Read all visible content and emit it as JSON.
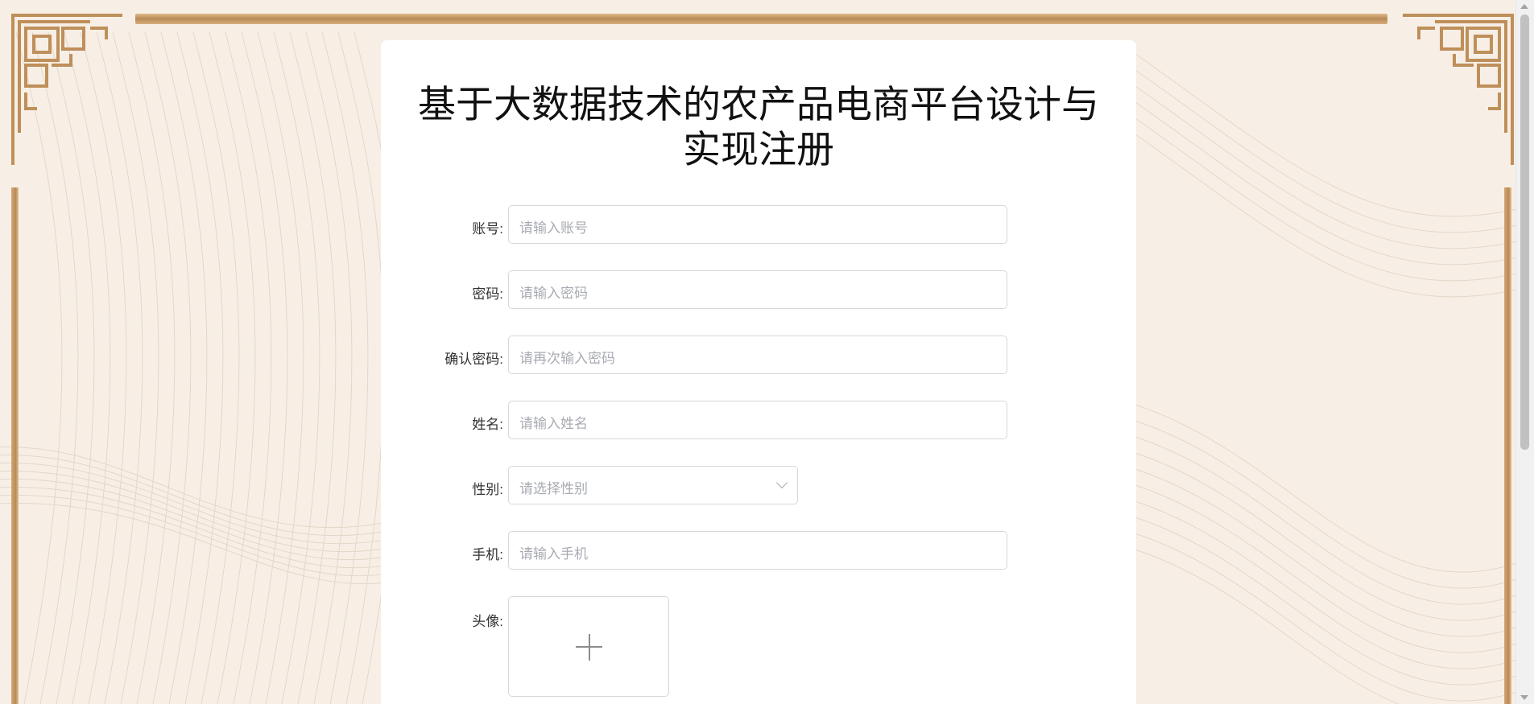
{
  "page": {
    "title": "基于大数据技术的农产品电商平台设计与实现注册"
  },
  "form": {
    "fields": [
      {
        "label": "账号:",
        "placeholder": "请输入账号",
        "type": "text"
      },
      {
        "label": "密码:",
        "placeholder": "请输入密码",
        "type": "password"
      },
      {
        "label": "确认密码:",
        "placeholder": "请再次输入密码",
        "type": "password"
      },
      {
        "label": "姓名:",
        "placeholder": "请输入姓名",
        "type": "text"
      },
      {
        "label": "性别:",
        "placeholder": "请选择性别",
        "type": "select"
      },
      {
        "label": "手机:",
        "placeholder": "请输入手机",
        "type": "text"
      }
    ],
    "avatar": {
      "label": "头像:",
      "icon": "plus-icon"
    }
  },
  "colors": {
    "background": "#f7efe6",
    "border_gold": "#b98a55",
    "card": "#ffffff",
    "placeholder": "#a8abb2",
    "input_border": "#d5d7dc"
  },
  "icons": {
    "corner_ornament": "chinese-fret-corner-icon",
    "select_arrow": "chevron-down-icon",
    "upload": "plus-icon"
  }
}
